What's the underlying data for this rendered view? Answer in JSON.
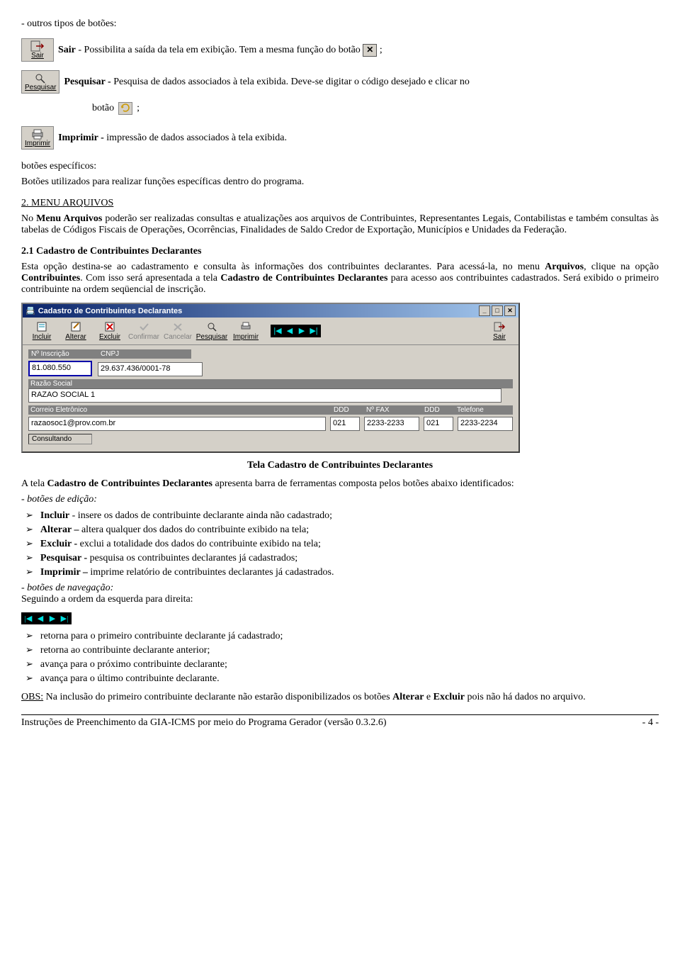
{
  "intro": {
    "heading": "- outros tipos de botões:",
    "sair_btn_label": "Sair",
    "sair_line_a": "Sair",
    "sair_line_b": " - Possibilita a saída da tela em exibição. Tem a mesma função  do botão ",
    "sair_line_c": " ;",
    "pesq_btn_label": "Pesquisar",
    "pesq_line_a": "Pesquisar - ",
    "pesq_line_b": "Pesquisa de dados associados à tela exibida. Deve-se digitar o código desejado e clicar no",
    "pesq_line2_a": "botão",
    "pesq_line2_b": " ;",
    "imp_btn_label": "Imprimir",
    "imp_line_a": "Imprimir - ",
    "imp_line_b": "impressão de dados associados à tela exibida.",
    "botoes_esp": "botões específicos:",
    "botoes_esp_desc": "Botões utilizados para realizar funções específicas dentro do programa."
  },
  "sec2": {
    "title": "2. MENU ARQUIVOS",
    "p1a": "No ",
    "p1b": "Menu Arquivos",
    "p1c": " poderão ser realizadas consultas e atualizações aos arquivos de Contribuintes, Representantes Legais, Contabilistas e também consultas às tabelas de Códigos Fiscais de Operações, Ocorrências, Finalidades de Saldo Credor de Exportação, Municípios e Unidades da Federação.",
    "subtitle": "2.1 Cadastro de Contribuintes Declarantes",
    "p2a": "Esta opção destina-se ao cadastramento e consulta às informações dos contribuintes declarantes. Para acessá-la, no menu ",
    "p2b": "Arquivos",
    "p2c": ", clique na opção ",
    "p2d": "Contribuintes",
    "p2e": ". Com isso será apresentada a tela ",
    "p2f": "Cadastro de Contribuintes Declarantes",
    "p2g": " para acesso aos contribuintes cadastrados. Será exibido o primeiro contribuinte na ordem seqüencial de inscrição."
  },
  "window": {
    "title": "Cadastro de Contribuintes Declarantes",
    "toolbar": {
      "incluir": "Incluir",
      "alterar": "Alterar",
      "excluir": "Excluir",
      "confirmar": "Confirmar",
      "cancelar": "Cancelar",
      "pesquisar": "Pesquisar",
      "imprimir": "Imprimir",
      "sair": "Sair"
    },
    "labels": {
      "n_inscricao": "Nº Inscrição",
      "cnpj": "CNPJ",
      "razao": "Razão Social",
      "correio": "Correio Eletrônico",
      "ddd": "DDD",
      "nfax": "Nº FAX",
      "ddd2": "DDD",
      "telefone": "Telefone"
    },
    "values": {
      "inscricao": "81.080.550",
      "cnpj": "29.637.436/0001-78",
      "razao": "RAZAO SOCIAL 1",
      "correio": "razaosoc1@prov.com.br",
      "ddd1": "021",
      "fax": "2233-2233",
      "ddd2": "021",
      "tel": "2233-2234"
    },
    "status": "Consultando"
  },
  "caption": "Tela Cadastro de Contribuintes Declarantes",
  "after": {
    "intro_a": "A tela ",
    "intro_b": "Cadastro de Contribuintes Declarantes",
    "intro_c": " apresenta barra de ferramentas composta pelos botões abaixo identificados:",
    "edicao_head": "- botões de edição:",
    "li1_a": "Incluir",
    "li1_b": " - insere os dados de contribuinte declarante ainda não cadastrado;",
    "li2_a": "Alterar –",
    "li2_b": " altera qualquer dos dados do contribuinte exibido na tela;",
    "li3_a": "Excluir - ",
    "li3_b": "exclui a totalidade dos dados do contribuinte exibido na tela;",
    "li4_a": "Pesquisar - ",
    "li4_b": "pesquisa os contribuintes declarantes já cadastrados;",
    "li5_a": "Imprimir –",
    "li5_b": " imprime relatório de contribuintes declarantes já cadastrados.",
    "nav_head": "- botões de navegação:",
    "nav_sub": " Seguindo a ordem da esquerda para direita:",
    "n1": "retorna para o primeiro contribuinte declarante já cadastrado;",
    "n2": "retorna ao contribuinte declarante anterior;",
    "n3": "avança para o próximo contribuinte declarante;",
    "n4": "avança para o último contribuinte declarante.",
    "obs_a": "OBS:",
    "obs_b": " Na inclusão do primeiro contribuinte declarante não estarão disponibilizados os botões ",
    "obs_c": "Alterar",
    "obs_d": " e ",
    "obs_e": "Excluir",
    "obs_f": " pois não há dados no arquivo."
  },
  "footer": {
    "left": "Instruções de Preenchimento da GIA-ICMS por meio do Programa Gerador (versão 0.3.2.6)",
    "right": "- 4 -"
  }
}
